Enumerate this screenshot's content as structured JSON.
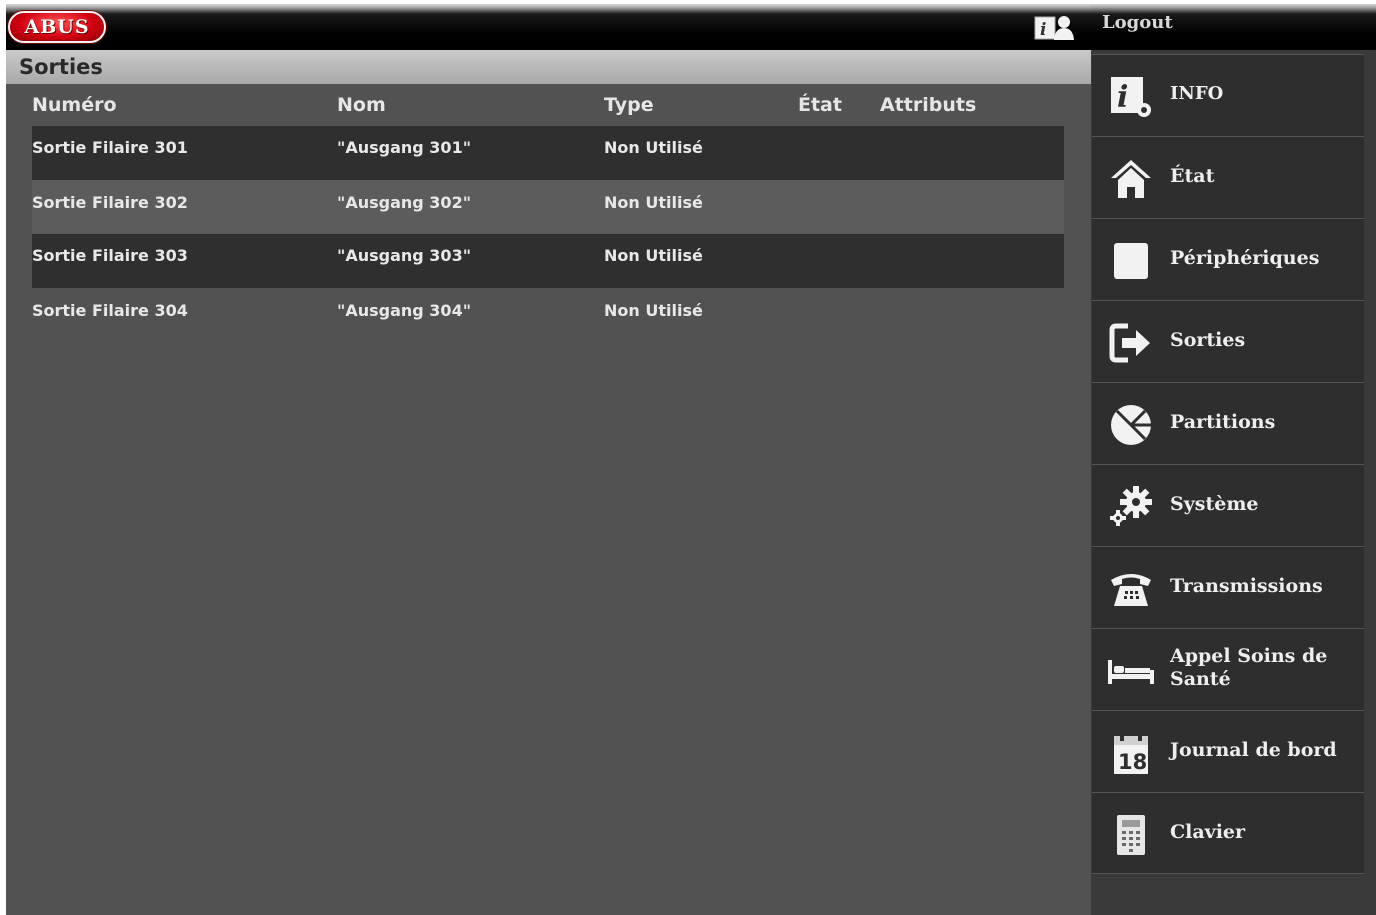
{
  "brand": {
    "logo_text": "ABUS"
  },
  "header": {
    "help_icon": "help-user-icon"
  },
  "page": {
    "title": "Sorties"
  },
  "table": {
    "columns": [
      "Numéro",
      "Nom",
      "Type",
      "État",
      "Attributs"
    ],
    "rows": [
      {
        "numero": "Sortie Filaire 301",
        "nom": "\"Ausgang 301\"",
        "type": "Non Utilisé",
        "etat": "",
        "attributs": ""
      },
      {
        "numero": "Sortie Filaire 302",
        "nom": "\"Ausgang 302\"",
        "type": "Non Utilisé",
        "etat": "",
        "attributs": ""
      },
      {
        "numero": "Sortie Filaire 303",
        "nom": "\"Ausgang 303\"",
        "type": "Non Utilisé",
        "etat": "",
        "attributs": ""
      },
      {
        "numero": "Sortie Filaire 304",
        "nom": "\"Ausgang 304\"",
        "type": "Non Utilisé",
        "etat": "",
        "attributs": ""
      }
    ]
  },
  "sidebar": {
    "logout_label": "Logout",
    "items": [
      {
        "label": "INFO",
        "icon": "info-settings-icon"
      },
      {
        "label": "État",
        "icon": "home-icon"
      },
      {
        "label": "Périphériques",
        "icon": "device-square-icon"
      },
      {
        "label": "Sorties",
        "icon": "exit-arrow-icon"
      },
      {
        "label": "Partitions",
        "icon": "partitions-pie-icon"
      },
      {
        "label": "Système",
        "icon": "gears-icon"
      },
      {
        "label": "Transmissions",
        "icon": "telephone-icon"
      },
      {
        "label": "Appel Soins de Santé",
        "icon": "bed-icon"
      },
      {
        "label": "Journal de bord",
        "icon": "calendar-icon"
      },
      {
        "label": "Clavier",
        "icon": "keypad-icon"
      }
    ]
  },
  "colors": {
    "background": "#525252",
    "row_dark": "#2f2f2f",
    "row_mid": "#5c5c5c",
    "sidebar": "#2e2e2e",
    "brand_red": "#d20010"
  }
}
